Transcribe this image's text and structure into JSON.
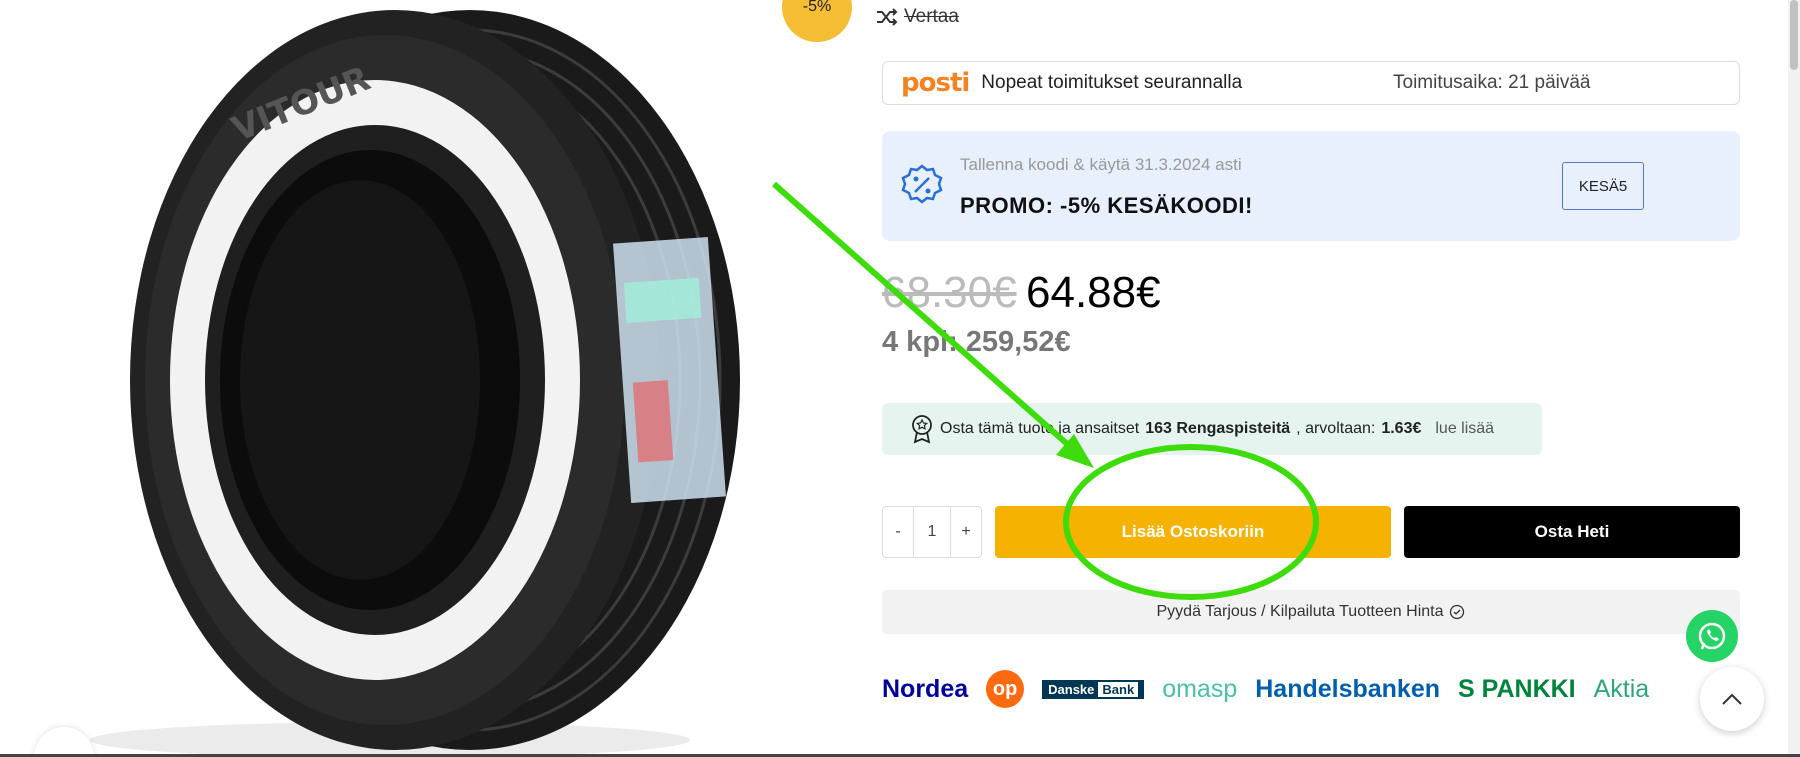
{
  "product": {
    "discount_badge": "-5%",
    "compare_label": "Vertaa"
  },
  "shipping": {
    "brand": "posti",
    "text": "Nopeat toimitukset seurannalla",
    "delivery_time": "Toimitusaika: 21 päivää"
  },
  "promo": {
    "subtitle": "Tallenna koodi & käytä 31.3.2024 asti",
    "title": "PROMO: -5% KESÄKOODI!",
    "code": "KESÄ5"
  },
  "price": {
    "old": "68.30€",
    "new": "64.88€",
    "quantity_total": "4 kpl: 259,52€"
  },
  "points": {
    "text_before": "Osta tämä tuote ja ansaitset",
    "points_value": "163 Rengaspisteitä",
    "text_mid": ", arvoltaan:",
    "value": "1.63€",
    "more_link": "lue lisää"
  },
  "cart": {
    "minus": "-",
    "quantity": "1",
    "plus": "+",
    "add_to_cart": "Lisää Ostoskoriin",
    "buy_now": "Osta Heti"
  },
  "offer": {
    "label": "Pyydä Tarjous / Kilpailuta Tuotteen Hinta"
  },
  "banks": {
    "nordea": "Nordea",
    "op": "op",
    "danske": "Danske",
    "danske_bank": "Bank",
    "omasp": "omasp",
    "handelsbanken": "Handelsbanken",
    "spankki": "S PANKKI",
    "aktia": "Aktia"
  },
  "tire": {
    "brand_text": "VITOUR"
  },
  "colors": {
    "badge": "#f5bd34",
    "add_to_cart": "#f5b200",
    "buy_now": "#000000",
    "promo_bg": "#e8f0fd",
    "points_bg": "#e6f4f0",
    "annotation": "#3ddc0a"
  },
  "icons": [
    "shuffle-icon",
    "percent-badge-icon",
    "award-icon",
    "check-circle-icon",
    "whatsapp-icon",
    "chevron-up-icon"
  ]
}
